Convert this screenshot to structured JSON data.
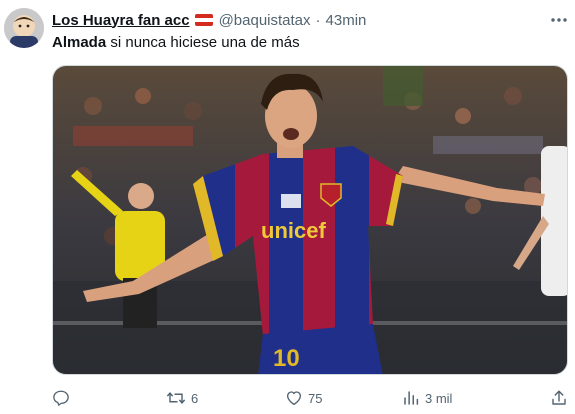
{
  "user": {
    "display_name": "Los Huayra fan acc",
    "flag_colors": [
      "#d52b1e",
      "#ffffff",
      "#d52b1e"
    ],
    "handle": "@baquistatax",
    "separator": "·",
    "time": "43min"
  },
  "tweet": {
    "bold_text": "Almada",
    "text": " si nunca hiciese una de más"
  },
  "media": {
    "kit_text": "unicef",
    "shirt_number": "10"
  },
  "actions": {
    "reply": {
      "icon": "reply-icon",
      "count": ""
    },
    "retweet": {
      "icon": "retweet-icon",
      "count": "6"
    },
    "like": {
      "icon": "heart-icon",
      "count": "75"
    },
    "views": {
      "icon": "views-icon",
      "count": "3 mil"
    },
    "share": {
      "icon": "share-icon",
      "count": ""
    }
  },
  "colors": {
    "text": "#0f1419",
    "secondary": "#536471",
    "barca_blue": "#1f2f8a",
    "barca_red": "#a51a3c"
  }
}
